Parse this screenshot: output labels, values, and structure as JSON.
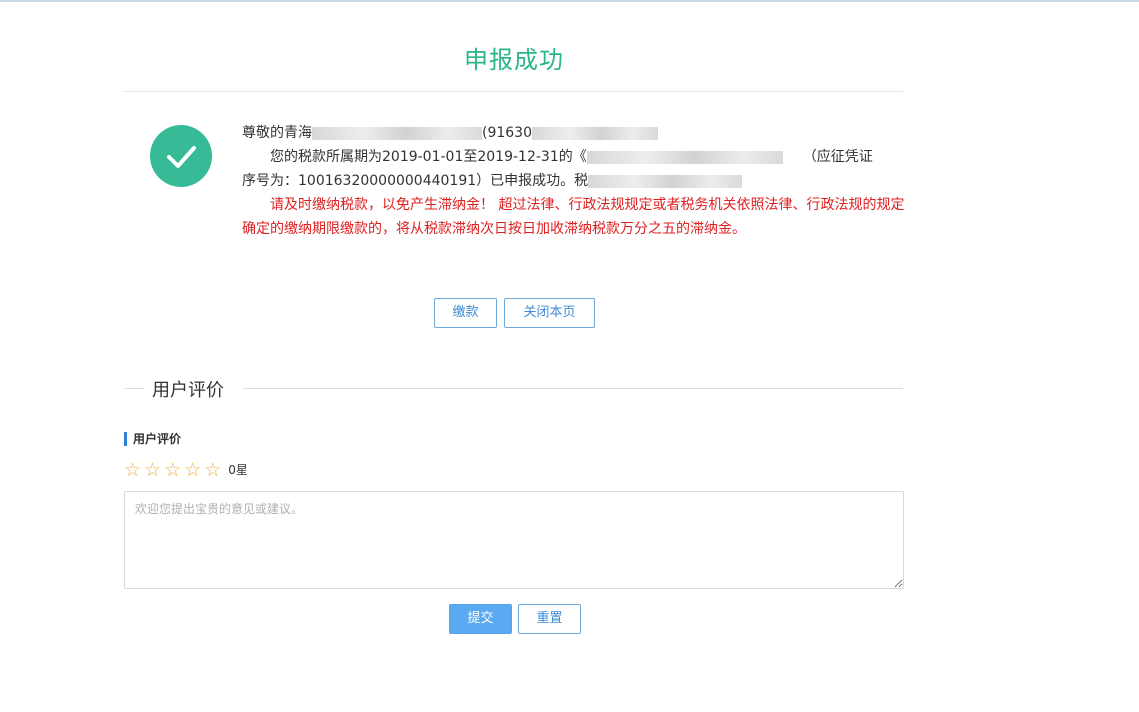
{
  "page": {
    "title": "申报成功"
  },
  "message": {
    "greeting_prefix": "尊敬的青海",
    "greeting_code_prefix": "(91630",
    "line2_prefix": "您的税款所属期为2019-01-01至2019-12-31的《",
    "line2_suffix": "（应征凭证",
    "line3": "序号为：10016320000000440191）已申报成功。税",
    "warning": "请及时缴纳税款，以免产生滞纳金！ 超过法律、行政法规规定或者税务机关依照法律、行政法规的规定确定的缴纳期限缴款的，将从税款滞纳次日按日加收滞纳税款万分之五的滞纳金。"
  },
  "actions": {
    "pay_label": "缴款",
    "close_label": "关闭本页"
  },
  "review": {
    "section_title": "用户评价",
    "sub_label": "用户评价",
    "star_icon": "star-outline-icon",
    "star_count": "0星",
    "rating": 0,
    "max_rating": 5,
    "comment_placeholder": "欢迎您提出宝贵的意见或建议。",
    "comment_value": "",
    "submit_label": "提交",
    "reset_label": "重置"
  },
  "colors": {
    "title": "#2bb58b",
    "success_icon": "#36bb96",
    "warning_text": "#e02020",
    "primary_button": "#59aaf0",
    "star": "#f0b433"
  }
}
